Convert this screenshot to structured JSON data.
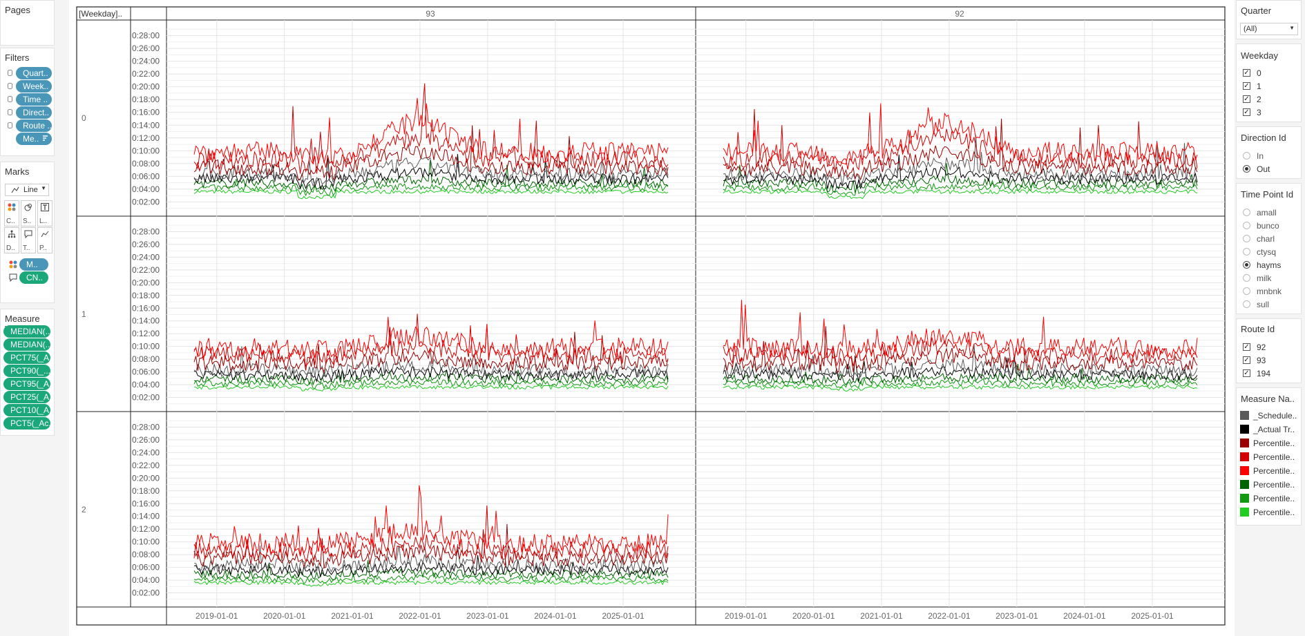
{
  "left": {
    "pages_title": "Pages",
    "filters_title": "Filters",
    "filters": [
      "Quart..",
      "Week..",
      "Time ..",
      "Direct..",
      "Route ..",
      "Me.."
    ],
    "marks_title": "Marks",
    "mark_type": "Line",
    "mark_cards": [
      "C..",
      "S..",
      "L..",
      "D..",
      "T..",
      "P.."
    ],
    "color_pill": "M..",
    "tooltip_pill": "CN..",
    "measure_values_title": "Measure Val..",
    "measure_values": [
      "MEDIAN(..",
      "MEDIAN(..",
      "PCT75(_A..",
      "PCT90(_...",
      "PCT95(_A..",
      "PCT25(_A..",
      "PCT10(_A..",
      "PCT5(_Ac.."
    ]
  },
  "right": {
    "quarter_title": "Quarter",
    "quarter_value": "(All)",
    "weekday_title": "Weekday",
    "weekday_items": [
      "0",
      "1",
      "2",
      "3"
    ],
    "direction_title": "Direction Id",
    "direction_items": [
      {
        "label": "In",
        "selected": false
      },
      {
        "label": "Out",
        "selected": true
      }
    ],
    "timepoint_title": "Time Point Id",
    "timepoint_items": [
      {
        "label": "amall",
        "selected": false
      },
      {
        "label": "bunco",
        "selected": false
      },
      {
        "label": "charl",
        "selected": false
      },
      {
        "label": "ctysq",
        "selected": false
      },
      {
        "label": "hayms",
        "selected": true
      },
      {
        "label": "milk",
        "selected": false
      },
      {
        "label": "mnbnk",
        "selected": false
      },
      {
        "label": "sull",
        "selected": false
      }
    ],
    "route_title": "Route Id",
    "route_items": [
      "92",
      "93",
      "194"
    ],
    "measure_names_title": "Measure Na..",
    "legend": [
      {
        "label": "_Schedule..",
        "color": "#5a5a5a"
      },
      {
        "label": "_Actual Tr..",
        "color": "#000000"
      },
      {
        "label": "Percentile..",
        "color": "#9b0000"
      },
      {
        "label": "Percentile..",
        "color": "#d20000"
      },
      {
        "label": "Percentile..",
        "color": "#ff0000"
      },
      {
        "label": "Percentile..",
        "color": "#006400"
      },
      {
        "label": "Percentile..",
        "color": "#119911"
      },
      {
        "label": "Percentile..",
        "color": "#22cc22"
      }
    ]
  },
  "grid": {
    "header_cell": "[Weekday]..",
    "columns": [
      "93",
      "92"
    ],
    "rows": [
      "0",
      "1",
      "2"
    ],
    "y_ticks": [
      "0:02:00",
      "0:04:00",
      "0:06:00",
      "0:08:00",
      "0:10:00",
      "0:12:00",
      "0:14:00",
      "0:16:00",
      "0:18:00",
      "0:20:00",
      "0:22:00",
      "0:24:00",
      "0:26:00",
      "0:28:00"
    ],
    "x_ticks": [
      "2019-01-01",
      "2020-01-01",
      "2021-01-01",
      "2022-01-01",
      "2023-01-01",
      "2024-01-01",
      "2025-01-01"
    ]
  },
  "chart_data": {
    "type": "line",
    "x_range": [
      "2018-09-01",
      "2025-08-31"
    ],
    "y_range_minutes": [
      0,
      30
    ],
    "series": [
      {
        "color": "#22cc22",
        "base_minutes": 3.6
      },
      {
        "color": "#119911",
        "base_minutes": 4.2
      },
      {
        "color": "#006400",
        "base_minutes": 4.9
      },
      {
        "color": "#000000",
        "base_minutes": 5.6
      },
      {
        "color": "#5a5a5a",
        "base_minutes": 6.3
      },
      {
        "color": "#9b0000",
        "base_minutes": 7.4
      },
      {
        "color": "#d20000",
        "base_minutes": 8.6
      },
      {
        "color": "#ff0000",
        "base_minutes": 9.8
      }
    ],
    "panels": [
      {
        "route": "93",
        "weekday": "0"
      },
      {
        "route": "92",
        "weekday": "0"
      },
      {
        "route": "93",
        "weekday": "1"
      },
      {
        "route": "92",
        "weekday": "1"
      },
      {
        "route": "93",
        "weekday": "2"
      }
    ]
  }
}
